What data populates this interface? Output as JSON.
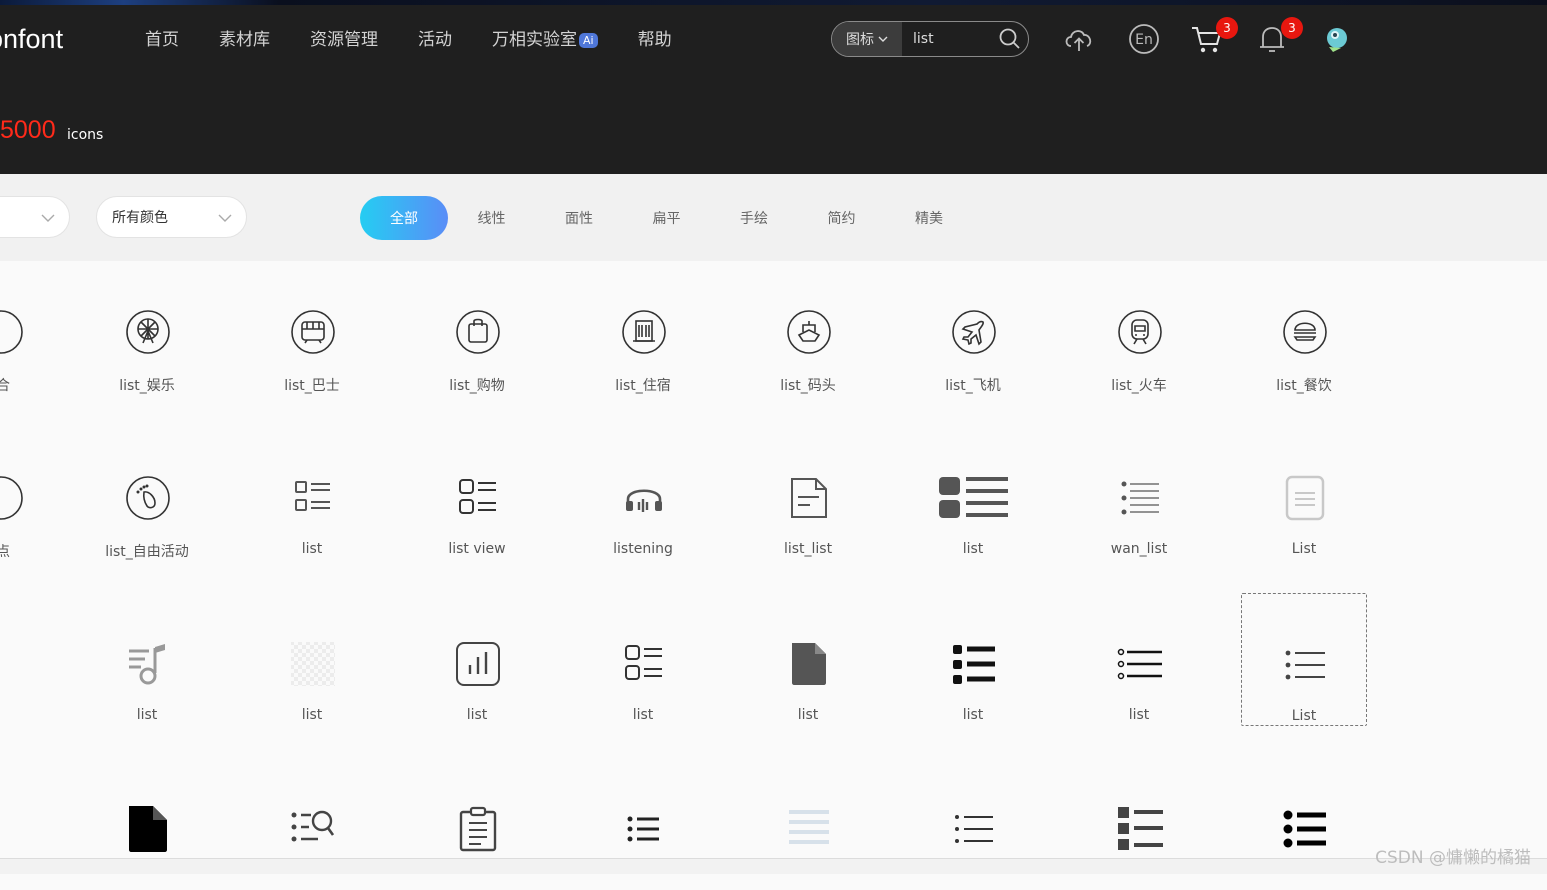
{
  "header": {
    "logo": "onfont",
    "nav": [
      "首页",
      "素材库",
      "资源管理",
      "活动",
      "万相实验室",
      "帮助"
    ],
    "nav_badge": "Ai",
    "search": {
      "type": "图标",
      "value": "list"
    },
    "cart_count": "3",
    "bell_count": "3",
    "icon_count": "5000",
    "icon_count_unit": "icons"
  },
  "filters": {
    "select_color": "所有颜色",
    "tabs": [
      "全部",
      "线性",
      "面性",
      "扁平",
      "手绘",
      "简约",
      "精美"
    ],
    "active_tab": "全部"
  },
  "grid": {
    "rows": [
      [
        {
          "label": "合",
          "icon": "circle-partial-icon"
        },
        {
          "label": "list_娱乐",
          "icon": "ferris-wheel-icon"
        },
        {
          "label": "list_巴士",
          "icon": "bus-icon"
        },
        {
          "label": "list_购物",
          "icon": "shopping-bag-icon"
        },
        {
          "label": "list_住宿",
          "icon": "hotel-icon"
        },
        {
          "label": "list_码头",
          "icon": "ship-icon"
        },
        {
          "label": "list_飞机",
          "icon": "airplane-icon"
        },
        {
          "label": "list_火车",
          "icon": "train-icon"
        },
        {
          "label": "list_餐饮",
          "icon": "burger-icon"
        }
      ],
      [
        {
          "label": "点",
          "icon": "circle-partial-icon"
        },
        {
          "label": "list_自由活动",
          "icon": "footprint-icon"
        },
        {
          "label": "list",
          "icon": "list-square-icon"
        },
        {
          "label": "list view",
          "icon": "list-view-icon"
        },
        {
          "label": "listening",
          "icon": "headphones-icon"
        },
        {
          "label": "list_list",
          "icon": "document-lines-icon"
        },
        {
          "label": "list",
          "icon": "list-bold-icon"
        },
        {
          "label": "wan_list",
          "icon": "dotted-list-icon"
        },
        {
          "label": "List",
          "icon": "doc-light-icon"
        }
      ],
      [
        {
          "label": "",
          "icon": "partial-icon"
        },
        {
          "label": "list",
          "icon": "music-list-icon"
        },
        {
          "label": "list",
          "icon": "transparent-icon"
        },
        {
          "label": "list",
          "icon": "bar-chart-icon"
        },
        {
          "label": "list",
          "icon": "list-view-icon"
        },
        {
          "label": "list",
          "icon": "file-filled-icon"
        },
        {
          "label": "list",
          "icon": "list-bullet-bold-icon"
        },
        {
          "label": "list",
          "icon": "circle-list-icon"
        },
        {
          "label": "List",
          "icon": "dot-list-icon"
        }
      ],
      [
        {
          "label": "",
          "icon": "none"
        },
        {
          "label": "",
          "icon": "file-black-icon"
        },
        {
          "label": "",
          "icon": "list-search-icon"
        },
        {
          "label": "",
          "icon": "clipboard-icon"
        },
        {
          "label": "",
          "icon": "bullet-list-icon"
        },
        {
          "label": "",
          "icon": "light-lines-icon"
        },
        {
          "label": "",
          "icon": "bullet-list-thin-icon"
        },
        {
          "label": "",
          "icon": "grid-list-icon"
        },
        {
          "label": "",
          "icon": "bold-bullet-icon"
        }
      ]
    ],
    "selected": "List"
  },
  "watermark": "CSDN @慵懒的橘猫"
}
